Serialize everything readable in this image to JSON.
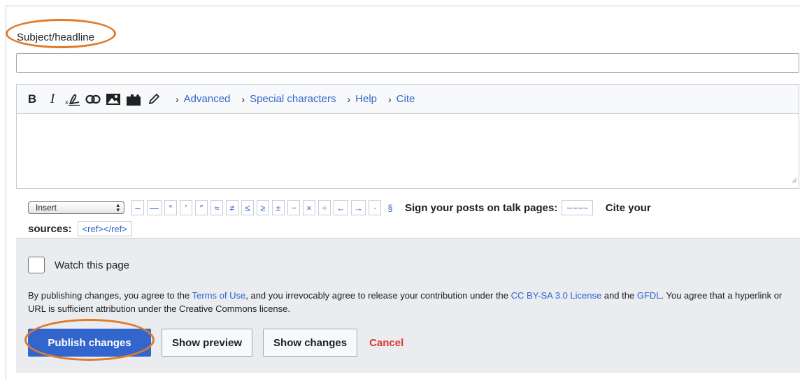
{
  "subject": {
    "label": "Subject/headline",
    "value": "",
    "placeholder": ""
  },
  "toolbar": {
    "icons": [
      "bold-icon",
      "italic-icon",
      "signature-icon",
      "link-icon",
      "image-icon",
      "puzzle-icon",
      "pencil-icon"
    ],
    "bold_label": "B",
    "italic_label": "I",
    "tabs": [
      {
        "label": "Advanced"
      },
      {
        "label": "Special characters"
      },
      {
        "label": "Help"
      },
      {
        "label": "Cite"
      }
    ]
  },
  "editor": {
    "value": ""
  },
  "special_chars": {
    "select_value": "Insert",
    "chars": [
      "–",
      "—",
      "°",
      "′",
      "″",
      "≈",
      "≠",
      "≤",
      "≥",
      "±",
      "−",
      "×",
      "÷",
      "←",
      "→",
      "·",
      "§"
    ],
    "sign_label": "Sign your posts on talk pages:",
    "signature": "~~~~",
    "cite_label": "Cite your",
    "sources_label": "sources:",
    "ref_tag": "<ref></ref>"
  },
  "options": {
    "watch_label": "Watch this page",
    "watch_checked": false,
    "license": {
      "t1": "By publishing changes, you agree to the ",
      "terms": "Terms of Use",
      "t2": ", and you irrevocably agree to release your contribution under the ",
      "cc": "CC BY-SA 3.0 License",
      "t3": " and the ",
      "gfdl": "GFDL",
      "t4": ". You agree that a hyperlink or URL is sufficient attribution under the Creative Commons license."
    }
  },
  "actions": {
    "publish": "Publish changes",
    "preview": "Show preview",
    "changes": "Show changes",
    "cancel": "Cancel"
  },
  "colors": {
    "link": "#3366cc",
    "primary": "#3366cc",
    "cancel": "#d33333",
    "highlight": "#e07b2b",
    "options_bg": "#eaecf0"
  }
}
